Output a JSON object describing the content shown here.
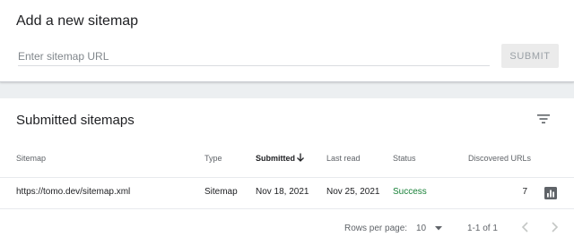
{
  "add_card": {
    "title": "Add a new sitemap",
    "input_placeholder": "Enter sitemap URL",
    "submit_label": "SUBMIT"
  },
  "list_card": {
    "title": "Submitted sitemaps",
    "icons": {
      "filter": "filter-icon",
      "sort": "arrow-down-icon",
      "report": "bar-chart-icon",
      "prev": "chevron-left-icon",
      "next": "chevron-right-icon",
      "dropdown": "caret-down-icon"
    },
    "columns": {
      "sitemap": "Sitemap",
      "type": "Type",
      "submitted": "Submitted",
      "last_read": "Last read",
      "status": "Status",
      "discovered": "Discovered URLs"
    },
    "rows": [
      {
        "sitemap": "https://tomo.dev/sitemap.xml",
        "type": "Sitemap",
        "submitted": "Nov 18, 2021",
        "last_read": "Nov 25, 2021",
        "status": "Success",
        "discovered": "7"
      }
    ],
    "pagination": {
      "rows_per_page_label": "Rows per page:",
      "rows_per_page_value": "10",
      "range": "1-1 of 1"
    }
  },
  "colors": {
    "success": "#188038",
    "background": "#eceff1",
    "icon": "#5f6368"
  }
}
